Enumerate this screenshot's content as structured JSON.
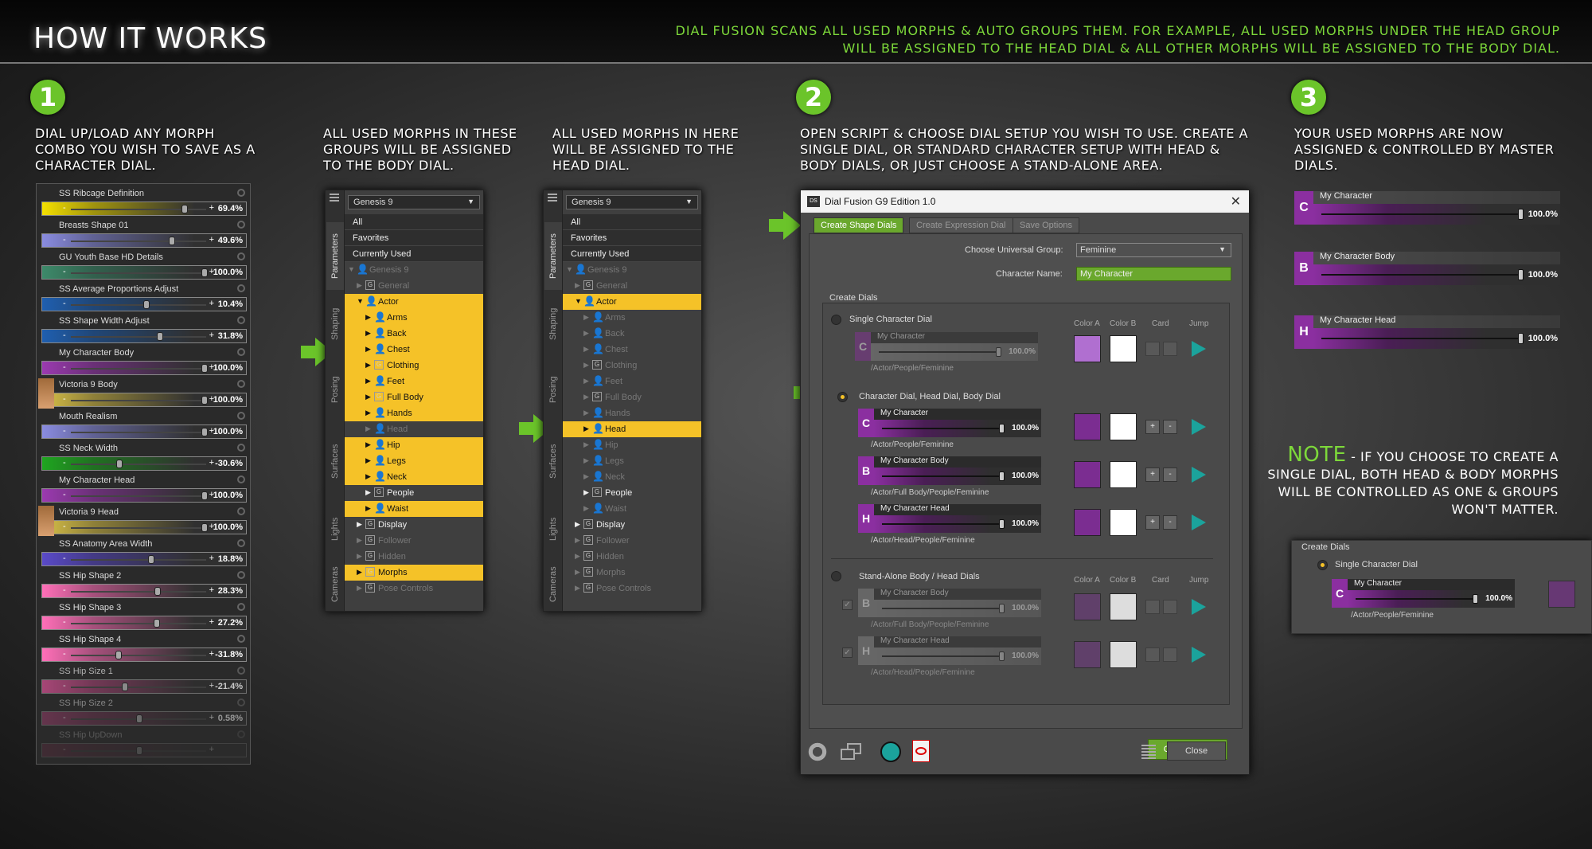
{
  "header": {
    "title": "HOW IT WORKS",
    "description": "DIAL FUSION SCANS ALL USED MORPHS & AUTO GROUPS THEM. FOR EXAMPLE, ALL USED MORPHS UNDER THE HEAD GROUP WILL BE ASSIGNED TO THE HEAD DIAL & ALL OTHER MORPHS WILL BE ASSIGNED TO THE BODY DIAL."
  },
  "steps": {
    "one": {
      "number": "1",
      "caption": "DIAL UP/LOAD ANY MORPH COMBO YOU WISH TO SAVE AS A CHARACTER DIAL."
    },
    "body_caption": "ALL USED MORPHS IN THESE GROUPS WILL BE ASSIGNED TO THE BODY DIAL.",
    "head_caption": "ALL USED MORPHS IN HERE WILL BE ASSIGNED TO THE HEAD DIAL.",
    "two": {
      "number": "2",
      "caption": "OPEN SCRIPT & CHOOSE DIAL SETUP YOU WISH TO USE. CREATE A SINGLE DIAL, OR STANDARD CHARACTER SETUP WITH HEAD & BODY DIALS, OR JUST CHOOSE A STAND-ALONE AREA."
    },
    "three": {
      "number": "3",
      "caption": "YOUR USED MORPHS ARE NOW ASSIGNED & CONTROLLED BY MASTER DIALS."
    }
  },
  "dials": [
    {
      "label": "SS Ribcage Definition",
      "value": "69.4%",
      "color": "#f5e000"
    },
    {
      "label": "Breasts Shape 01",
      "value": "49.6%",
      "color": "#8a8ce0"
    },
    {
      "label": "GU Youth Base HD Details",
      "value": "100.0%",
      "color": "#3d8a6a"
    },
    {
      "label": "SS Average Proportions Adjust",
      "value": "10.4%",
      "color": "#1f5fb0"
    },
    {
      "label": "SS Shape Width Adjust",
      "value": "31.8%",
      "color": "#1f5fb0"
    },
    {
      "label": "My Character Body",
      "value": "100.0%",
      "color": "#9b3ab0"
    },
    {
      "label": "Victoria 9 Body",
      "value": "100.0%",
      "color": "#d8c048"
    },
    {
      "label": "Mouth Realism",
      "value": "100.0%",
      "color": "#8a8ce0"
    },
    {
      "label": "SS Neck Width",
      "value": "-30.6%",
      "color": "#1fa520"
    },
    {
      "label": "My Character Head",
      "value": "100.0%",
      "color": "#9b3ab0"
    },
    {
      "label": "Victoria 9 Head",
      "value": "100.0%",
      "color": "#d8c048"
    },
    {
      "label": "SS Anatomy Area Width",
      "value": "18.8%",
      "color": "#5a4ac8"
    },
    {
      "label": "SS Hip Shape 2",
      "value": "28.3%",
      "color": "#ff6fb8"
    },
    {
      "label": "SS Hip Shape 3",
      "value": "27.2%",
      "color": "#ff6fb8"
    },
    {
      "label": "SS Hip Shape 4",
      "value": "-31.8%",
      "color": "#ff6fb8"
    },
    {
      "label": "SS Hip Size 1",
      "value": "-21.4%",
      "color": "#d05090"
    },
    {
      "label": "SS Hip Size 2",
      "value": "0.58%",
      "color": "#a04070"
    },
    {
      "label": "SS Hip UpDown",
      "value": "",
      "color": "#803050"
    }
  ],
  "tree_tabs": [
    "Parameters",
    "Shaping",
    "Posing",
    "Surfaces",
    "Lights",
    "Cameras"
  ],
  "tree_body": {
    "figure": "Genesis 9",
    "rows": [
      "All",
      "Favorites",
      "Currently Used",
      "Genesis 9",
      "General",
      "Actor",
      "Arms",
      "Back",
      "Chest",
      "Clothing",
      "Feet",
      "Full Body",
      "Hands",
      "Head",
      "Hip",
      "Legs",
      "Neck",
      "People",
      "Waist",
      "Display",
      "Follower",
      "Hidden",
      "Morphs",
      "Pose Controls"
    ]
  },
  "tree_head": {
    "figure": "Genesis 9",
    "rows": [
      "All",
      "Favorites",
      "Currently Used",
      "Genesis 9",
      "General",
      "Actor",
      "Arms",
      "Back",
      "Chest",
      "Clothing",
      "Feet",
      "Full Body",
      "Hands",
      "Head",
      "Hip",
      "Legs",
      "Neck",
      "People",
      "Waist",
      "Display",
      "Follower",
      "Hidden",
      "Morphs",
      "Pose Controls"
    ]
  },
  "dialog": {
    "title": "Dial Fusion G9 Edition 1.0",
    "app_badge": "DS",
    "tabs": [
      "Create Shape Dials",
      "Create Expression Dial",
      "Save Options"
    ],
    "universal_group_label": "Choose Universal Group:",
    "universal_group_value": "Feminine",
    "character_name_label": "Character Name:",
    "character_name_value": "My Character",
    "create_dials_label": "Create Dials",
    "col_color_a": "Color A",
    "col_color_b": "Color B",
    "col_card": "Card",
    "col_jump": "Jump",
    "option_single": "Single Character Dial",
    "option_character": "Character Dial, Head Dial, Body Dial",
    "option_standalone": "Stand-Alone Body / Head Dials",
    "dial_character": "My Character",
    "dial_body": "My Character Body",
    "dial_head": "My Character Head",
    "dial_value": "100.0%",
    "path_character": "/Actor/People/Feminine",
    "path_body": "/Actor/Full Body/People/Feminine",
    "path_head": "/Actor/Head/People/Feminine",
    "letter_c": "C",
    "letter_b": "B",
    "letter_h": "H",
    "plus": "+",
    "minus": "-",
    "create_button": "Create Dials",
    "close_button": "Close",
    "colors": {
      "purple": "#7b2d91",
      "light_purple": "#b06fd0",
      "white": "#ffffff",
      "teal": "#1ba39c"
    }
  },
  "master_dials": [
    {
      "letter": "C",
      "label": "My Character",
      "value": "100.0%"
    },
    {
      "letter": "B",
      "label": "My Character Body",
      "value": "100.0%"
    },
    {
      "letter": "H",
      "label": "My Character Head",
      "value": "100.0%"
    }
  ],
  "note": {
    "keyword": "NOTE",
    "text": " - IF YOU CHOOSE TO CREATE A SINGLE DIAL, BOTH HEAD & BODY MORPHS WILL BE CONTROLLED AS ONE & GROUPS WON'T MATTER."
  },
  "mini_panel": {
    "create_dials_label": "Create Dials",
    "option_single": "Single Character Dial",
    "dial_label": "My Character",
    "dial_value": "100.0%",
    "letter": "C",
    "path": "/Actor/People/Feminine"
  },
  "accent_color": "#6bc42a",
  "highlight_color": "#f5c228"
}
